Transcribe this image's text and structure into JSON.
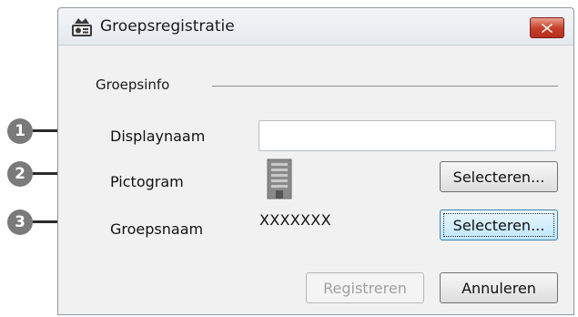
{
  "window": {
    "title": "Groepsregistratie",
    "app_icon": "projector-icon",
    "close_icon": "close-icon"
  },
  "group": {
    "label": "Groepsinfo"
  },
  "rows": {
    "display_name": {
      "label": "Displaynaam",
      "value": ""
    },
    "pictogram": {
      "label": "Pictogram",
      "icon": "building-icon",
      "select_label": "Selecteren..."
    },
    "group_name": {
      "label": "Groepsnaam",
      "value": "XXXXXXX",
      "select_label": "Selecteren..."
    }
  },
  "buttons": {
    "register_label": "Registreren",
    "cancel_label": "Annuleren"
  },
  "callouts": [
    "1",
    "2",
    "3"
  ],
  "colors": {
    "close_button": "#c8432e",
    "callout": "#7a7a7a",
    "focus_button": "#bee6fd"
  }
}
